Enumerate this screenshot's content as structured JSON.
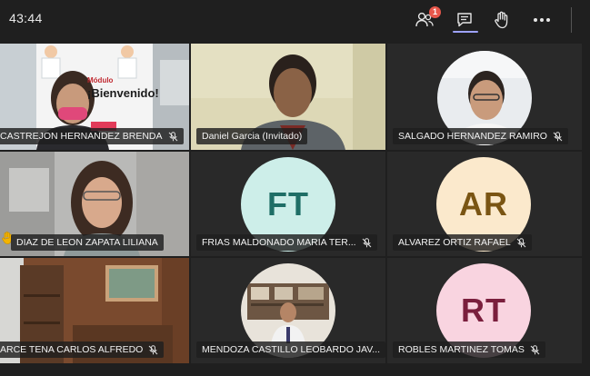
{
  "call": {
    "timer": "43:44",
    "participants_badge": "1"
  },
  "toolbar": {
    "participants_icon": "people-icon",
    "chat_icon": "chat-icon",
    "raise_hand_icon": "raise-hand-icon",
    "more_icon": "more-options-icon"
  },
  "participants": [
    {
      "name": "CASTREJON HERNANDEZ BRENDA",
      "type": "video",
      "muted": true
    },
    {
      "name": "Daniel Garcia (Invitado)",
      "type": "video",
      "muted": false
    },
    {
      "name": "SALGADO HERNANDEZ RAMIRO",
      "type": "video",
      "muted": true
    },
    {
      "name": "DIAZ DE LEON ZAPATA LILIANA",
      "type": "video",
      "muted": false,
      "hand_raised": true
    },
    {
      "name": "FRIAS MALDONADO MARIA TER...",
      "type": "avatar",
      "initials": "FT",
      "avatar_bg": "#cdeee9",
      "avatar_fg": "#1f6e66",
      "muted": true
    },
    {
      "name": "ALVAREZ ORTIZ RAFAEL",
      "type": "avatar",
      "initials": "AR",
      "avatar_bg": "#fbe9cc",
      "avatar_fg": "#7a5513",
      "muted": true
    },
    {
      "name": "ARCE TENA CARLOS ALFREDO",
      "type": "video",
      "muted": true
    },
    {
      "name": "MENDOZA CASTILLO LEOBARDO JAV...",
      "type": "video",
      "muted": true
    },
    {
      "name": "ROBLES MARTINEZ TOMAS",
      "type": "avatar",
      "initials": "RT",
      "avatar_bg": "#f9d4e0",
      "avatar_fg": "#7a1f3d",
      "muted": true
    }
  ],
  "background_sign": {
    "line1": "Módulo",
    "line2": "¡Bienvenido!"
  },
  "colors": {
    "badge": "#e7574b",
    "accent": "#9ea2ff"
  }
}
